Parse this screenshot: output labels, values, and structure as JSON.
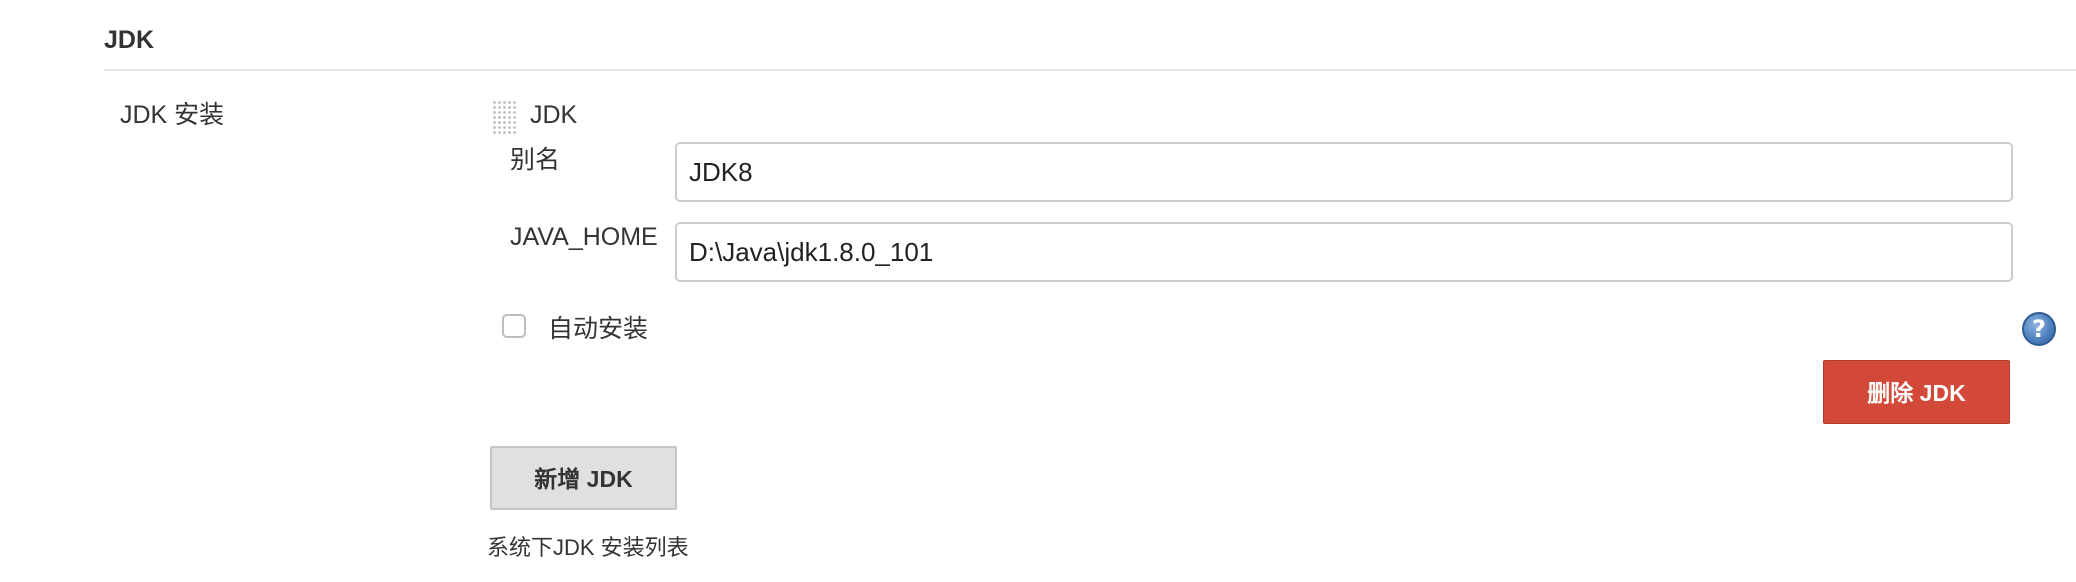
{
  "section": {
    "title": "JDK"
  },
  "jdk_installations": {
    "label": "JDK 安装",
    "item": {
      "title": "JDK",
      "alias_label": "别名",
      "alias_value": "JDK8",
      "java_home_label": "JAVA_HOME",
      "java_home_value": "D:\\Java\\jdk1.8.0_101",
      "auto_install_label": "自动安装",
      "auto_install_checked": false,
      "delete_button_label": "删除 JDK"
    },
    "add_button_label": "新增 JDK",
    "description": "系统下JDK 安装列表"
  },
  "icons": {
    "help": "help-icon",
    "drag": "drag-handle-icon"
  },
  "colors": {
    "delete_button": "#d24939",
    "add_button": "#e0e0e0",
    "help_icon": "#4f82c0"
  }
}
